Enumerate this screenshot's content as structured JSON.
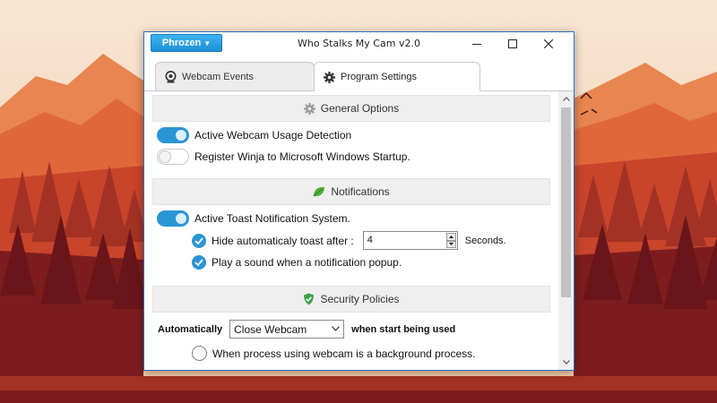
{
  "window": {
    "title": "Who Stalks My Cam v2.0",
    "brand_button": "Phrozen"
  },
  "tabs": [
    {
      "label": "Webcam Events",
      "icon": "webcam-icon",
      "active": false
    },
    {
      "label": "Program Settings",
      "icon": "gear-icon",
      "active": true
    }
  ],
  "sections": {
    "general": {
      "title": "General Options",
      "icon": "gear-icon",
      "options": [
        {
          "label": "Active Webcam Usage Detection",
          "enabled": true
        },
        {
          "label": "Register Winja to Microsoft Windows Startup.",
          "enabled": false
        }
      ]
    },
    "notifications": {
      "title": "Notifications",
      "icon": "leaf-icon",
      "toast_label": "Active Toast Notification System.",
      "toast_enabled": true,
      "hide_label": "Hide automaticaly toast after :",
      "hide_checked": true,
      "hide_value": "4",
      "hide_unit": "Seconds.",
      "sound_label": "Play a sound when a notification popup.",
      "sound_checked": true
    },
    "security": {
      "title": "Security Policies",
      "icon": "shield-icon",
      "automatically_label": "Automatically",
      "action_value": "Close Webcam",
      "after_label": "when start being used",
      "radio_label": "When process using webcam is a background process.",
      "radio_selected": false
    }
  },
  "colors": {
    "accent": "#2a95d4",
    "window_border": "#2b6fc7",
    "brand": "#1c8fd7",
    "sky": "#f7dcc6",
    "mountain": "#e36a3c",
    "forest": "#8e2320"
  }
}
